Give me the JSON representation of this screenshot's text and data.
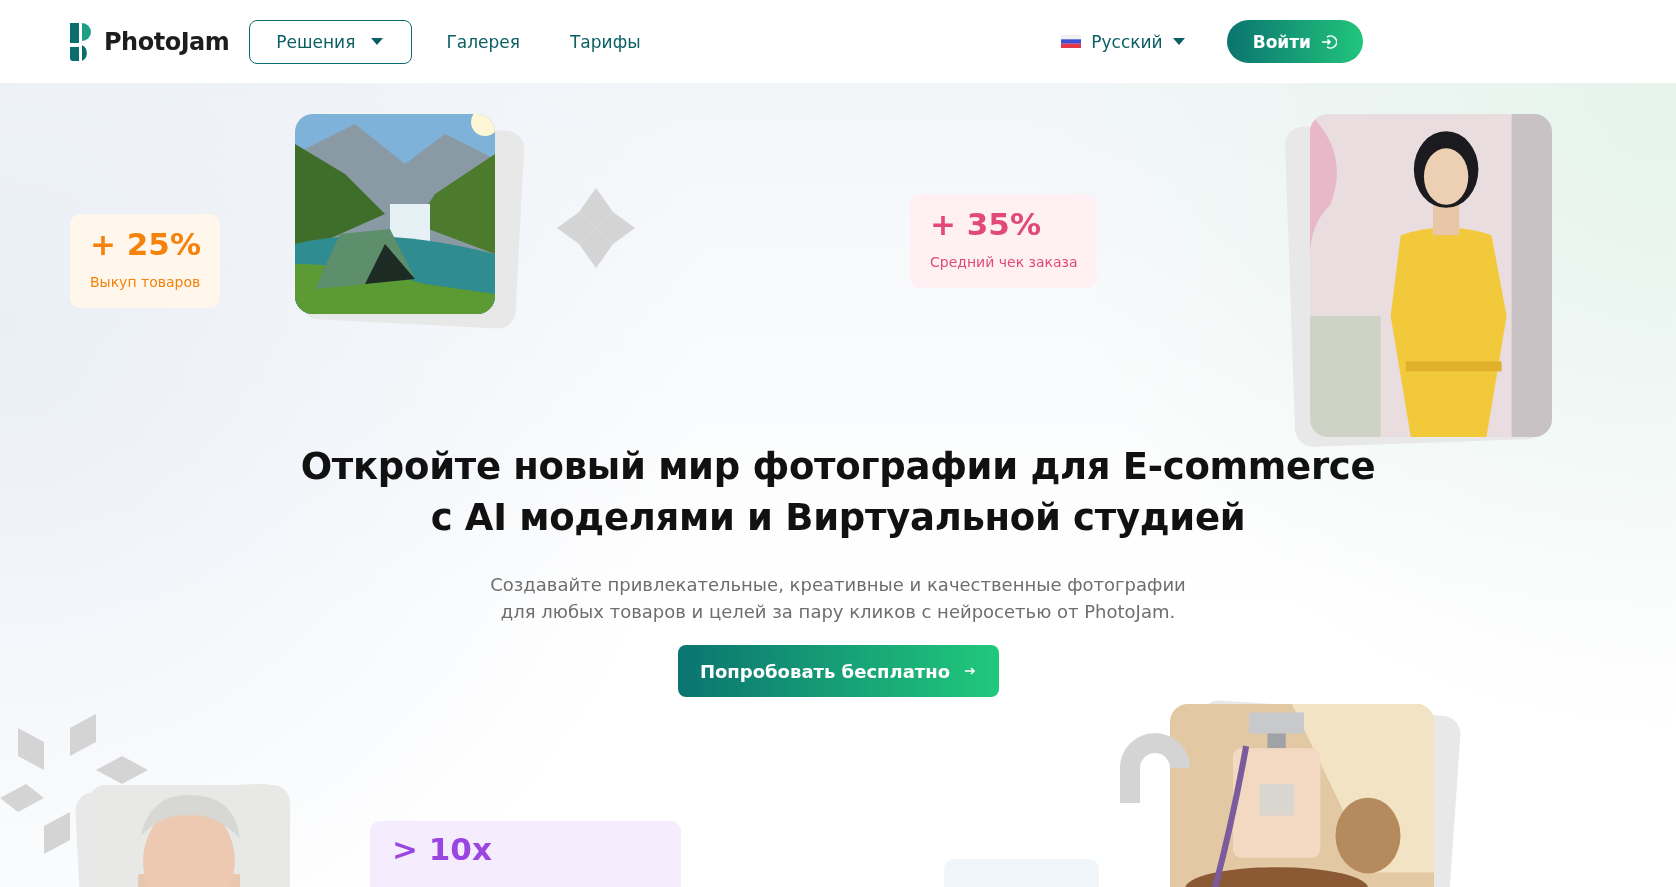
{
  "header": {
    "logo": "PhotoJam",
    "nav": [
      {
        "label": "Решения",
        "kind": "dropdown"
      },
      {
        "label": "Галерея",
        "kind": "link"
      },
      {
        "label": "Тарифы",
        "kind": "link"
      }
    ],
    "language": "Русский",
    "login": "Войти"
  },
  "stats": [
    {
      "value": "+ 25%",
      "caption": "Выкуп товаров",
      "color": "#f5820b"
    },
    {
      "value": "+ 35%",
      "caption": "Средний чек заказа",
      "color": "#e0497a"
    },
    {
      "value": "> 10x",
      "color": "#9b45e0"
    }
  ],
  "hero": {
    "title": [
      "Откройте новый мир фотографии для E-commerce",
      "с AI моделями и Виртуальной студией"
    ],
    "subtitle": [
      "Создавайте привлекательные, креативные и качественные фотографии",
      "для любых товаров и целей за пару кликов с нейросетью от PhotoJam."
    ],
    "cta": "Попробовать бесплатно"
  }
}
